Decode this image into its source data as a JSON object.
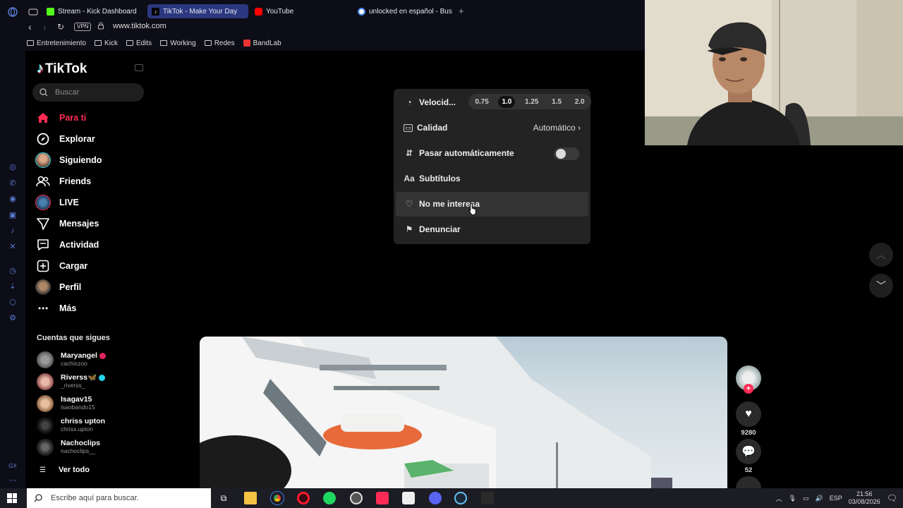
{
  "browser": {
    "tabs": [
      {
        "label": "Stream - Kick Dashboard",
        "color": "#53fc18"
      },
      {
        "label": "TikTok - Make Your Day",
        "color": "#ffffff",
        "active": true
      },
      {
        "label": "YouTube",
        "color": "#ff0000"
      },
      {
        "label": "unlocked en español - Bus",
        "color": "#4285f4"
      }
    ],
    "vpn_label": "VPN",
    "url": "www.tiktok.com",
    "bookmarks": [
      "Entretenimiento",
      "Kick",
      "Edits",
      "Working",
      "Redes",
      "BandLab"
    ]
  },
  "sidebar": {
    "logo": "TikTok",
    "search_placeholder": "Buscar",
    "nav": [
      {
        "label": "Para ti",
        "icon": "home-icon",
        "active": true
      },
      {
        "label": "Explorar",
        "icon": "compass-icon"
      },
      {
        "label": "Siguiendo",
        "icon": "avatar"
      },
      {
        "label": "Friends",
        "icon": "friends-icon"
      },
      {
        "label": "LIVE",
        "icon": "live-icon"
      },
      {
        "label": "Mensajes",
        "icon": "send-icon"
      },
      {
        "label": "Actividad",
        "icon": "message-icon"
      },
      {
        "label": "Cargar",
        "icon": "plus-square-icon"
      },
      {
        "label": "Perfil",
        "icon": "avatar"
      },
      {
        "label": "Más",
        "icon": "more-icon"
      }
    ],
    "following_title": "Cuentas que sigues",
    "accounts": [
      {
        "name": "Maryangel",
        "handle": "cachixzoo",
        "badge": "#e0245e"
      },
      {
        "name": "Riverss🦋",
        "handle": "_riverss_",
        "badge": "#20d5ec"
      },
      {
        "name": "Isagav15",
        "handle": "isaobando15"
      },
      {
        "name": "chriss upton",
        "handle": "chriss.upton"
      },
      {
        "name": "Nachoclips",
        "handle": "nachoclips__"
      }
    ],
    "see_all": "Ver todo"
  },
  "popup": {
    "speed_label": "Velocid...",
    "speeds": [
      "0.75",
      "1.0",
      "1.25",
      "1.5",
      "2.0"
    ],
    "selected_speed": "1.0",
    "quality_label": "Calidad",
    "quality_value": "Automático",
    "autoscroll_label": "Pasar automáticamente",
    "autoscroll_on": false,
    "subtitles_label": "Subtítulos",
    "not_interested_label": "No me interesa",
    "report_label": "Denunciar"
  },
  "actions": {
    "likes": "9280",
    "comments": "52"
  },
  "taskbar": {
    "search_placeholder": "Escribe aquí para buscar.",
    "language": "ESP",
    "time": "21:56",
    "date": "03/08/2026"
  },
  "colors": {
    "accent": "#fe2c55",
    "active_tab": "#2b3880",
    "popup_bg": "#232323"
  }
}
